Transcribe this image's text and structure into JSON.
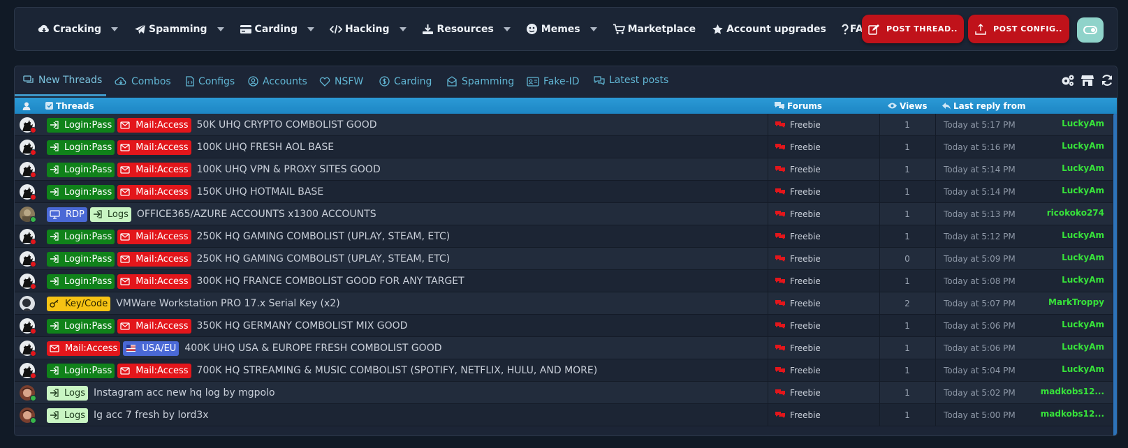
{
  "nav": {
    "items": [
      {
        "label": "Cracking",
        "icon": "cloud-download-icon",
        "dropdown": true
      },
      {
        "label": "Spamming",
        "icon": "paper-plane-icon",
        "dropdown": true
      },
      {
        "label": "Carding",
        "icon": "credit-card-icon",
        "dropdown": true
      },
      {
        "label": "Hacking",
        "icon": "code-icon",
        "dropdown": true
      },
      {
        "label": "Resources",
        "icon": "download-icon",
        "dropdown": true
      },
      {
        "label": "Memes",
        "icon": "meme-icon",
        "dropdown": true
      },
      {
        "label": "Marketplace",
        "icon": "cart-icon",
        "dropdown": false
      },
      {
        "label": "Account upgrades",
        "icon": "star-icon",
        "dropdown": false
      },
      {
        "label": "FAQs",
        "icon": "question-icon",
        "dropdown": false
      }
    ],
    "post_thread": "POST THREAD..",
    "post_config": "POST CONFIG.."
  },
  "tabs": [
    {
      "label": "New Threads",
      "icon": "threads-icon",
      "active": true
    },
    {
      "label": "Combos",
      "icon": "cloud-download-icon"
    },
    {
      "label": "Configs",
      "icon": "file-code-icon"
    },
    {
      "label": "Accounts",
      "icon": "user-circle-icon"
    },
    {
      "label": "NSFW",
      "icon": "heart-icon"
    },
    {
      "label": "Carding",
      "icon": "dollar-circle-icon"
    },
    {
      "label": "Spamming",
      "icon": "mail-box-icon"
    },
    {
      "label": "Fake-ID",
      "icon": "id-card-icon"
    },
    {
      "label": "Latest posts",
      "icon": "comments-icon"
    }
  ],
  "table": {
    "headers": {
      "threads": "Threads",
      "forums": "Forums",
      "views": "Views",
      "last_reply": "Last reply from"
    },
    "rows": [
      {
        "avatar": "ninja",
        "status": "red",
        "badges": [
          "login",
          "mail"
        ],
        "title": "50K UHQ CRYPTO COMBOLIST GOOD",
        "forum": "Freebie",
        "views": "1",
        "date": "Today at 5:17 PM",
        "user": "LuckyAm"
      },
      {
        "avatar": "ninja",
        "status": "red",
        "badges": [
          "login",
          "mail"
        ],
        "title": "100K UHQ FRESH AOL BASE",
        "forum": "Freebie",
        "views": "1",
        "date": "Today at 5:16 PM",
        "user": "LuckyAm"
      },
      {
        "avatar": "ninja",
        "status": "red",
        "badges": [
          "login",
          "mail"
        ],
        "title": "100K UHQ VPN & PROXY SITES GOOD",
        "forum": "Freebie",
        "views": "1",
        "date": "Today at 5:14 PM",
        "user": "LuckyAm"
      },
      {
        "avatar": "ninja",
        "status": "red",
        "badges": [
          "login",
          "mail"
        ],
        "title": "150K UHQ HOTMAIL BASE",
        "forum": "Freebie",
        "views": "1",
        "date": "Today at 5:14 PM",
        "user": "LuckyAm"
      },
      {
        "avatar": "photo",
        "status": "green",
        "badges": [
          "rdp",
          "logs"
        ],
        "title": "OFFICE365/AZURE ACCOUNTS x1300 ACCOUNTS",
        "forum": "Freebie",
        "views": "1",
        "date": "Today at 5:13 PM",
        "user": "ricokoko274"
      },
      {
        "avatar": "ninja",
        "status": "red",
        "badges": [
          "login",
          "mail"
        ],
        "title": "250K HQ GAMING COMBOLIST (UPLAY, STEAM, ETC)",
        "forum": "Freebie",
        "views": "1",
        "date": "Today at 5:12 PM",
        "user": "LuckyAm"
      },
      {
        "avatar": "ninja",
        "status": "red",
        "badges": [
          "login",
          "mail"
        ],
        "title": "250K HQ GAMING COMBOLIST (UPLAY, STEAM, ETC)",
        "forum": "Freebie",
        "views": "0",
        "date": "Today at 5:09 PM",
        "user": "LuckyAm"
      },
      {
        "avatar": "ninja",
        "status": "red",
        "badges": [
          "login",
          "mail"
        ],
        "title": "300K HQ FRANCE COMBOLIST GOOD FOR ANY TARGET",
        "forum": "Freebie",
        "views": "1",
        "date": "Today at 5:08 PM",
        "user": "LuckyAm"
      },
      {
        "avatar": "bw",
        "status": "none",
        "badges": [
          "key"
        ],
        "title": "VMWare Workstation PRO 17.x Serial Key (x2)",
        "forum": "Freebie",
        "views": "2",
        "date": "Today at 5:07 PM",
        "user": "MarkTroppy"
      },
      {
        "avatar": "ninja",
        "status": "red",
        "badges": [
          "login",
          "mail"
        ],
        "title": "350K HQ GERMANY COMBOLIST MIX GOOD",
        "forum": "Freebie",
        "views": "1",
        "date": "Today at 5:06 PM",
        "user": "LuckyAm"
      },
      {
        "avatar": "ninja",
        "status": "red",
        "badges": [
          "mail",
          "usa"
        ],
        "title": "400K UHQ USA & EUROPE FRESH COMBOLIST GOOD",
        "forum": "Freebie",
        "views": "1",
        "date": "Today at 5:06 PM",
        "user": "LuckyAm"
      },
      {
        "avatar": "ninja",
        "status": "red",
        "badges": [
          "login",
          "mail"
        ],
        "title": "700K HQ STREAMING & MUSIC COMBOLIST (SPOTIFY, NETFLIX, HULU, AND MORE)",
        "forum": "Freebie",
        "views": "1",
        "date": "Today at 5:04 PM",
        "user": "LuckyAm"
      },
      {
        "avatar": "anime",
        "status": "green",
        "badges": [
          "logs"
        ],
        "title": "Instagram acc new hq log by mgpolo",
        "forum": "Freebie",
        "views": "1",
        "date": "Today at 5:02 PM",
        "user": "madkobs12..."
      },
      {
        "avatar": "anime",
        "status": "green",
        "badges": [
          "logs"
        ],
        "title": "Ig acc 7 fresh by lord3x",
        "forum": "Freebie",
        "views": "1",
        "date": "Today at 5:00 PM",
        "user": "madkobs12..."
      }
    ]
  },
  "badge_labels": {
    "login": "Login:Pass",
    "mail": "Mail:Access",
    "rdp": "RDP",
    "logs": "Logs",
    "key": "Key/Code",
    "usa": "USA/EU"
  },
  "colors": {
    "accent": "#2b9ad6",
    "post_button": "#c0121a",
    "username": "#37e23a",
    "badge_login": "#10821a",
    "badge_mail": "#e3161b",
    "badge_rdp": "#4a69d6",
    "badge_logs": "#c9f5c3",
    "badge_key": "#f6c314"
  }
}
